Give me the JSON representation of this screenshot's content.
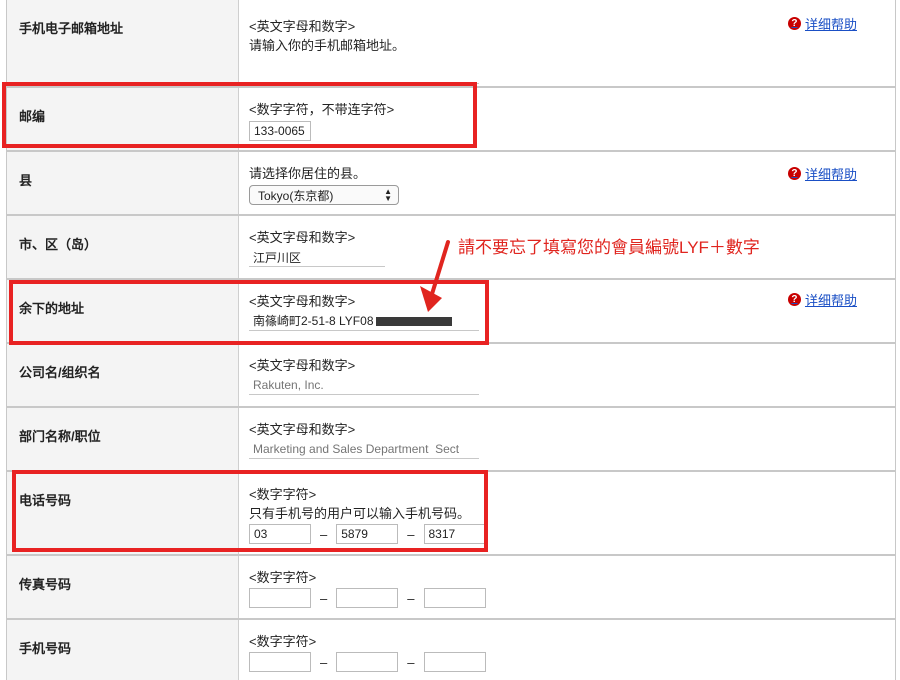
{
  "help_label": "详细帮助",
  "help_icon": "question-circle-icon",
  "rows": {
    "email": {
      "label": "手机电子邮箱地址",
      "hint1": "<英文字母和数字>",
      "hint2": "请输入你的手机邮箱地址。",
      "value": ""
    },
    "zip": {
      "label": "邮编",
      "hint1": "<数字字符，不带连字符>",
      "value": "133-0065"
    },
    "prefecture": {
      "label": "县",
      "hint1": "请选择你居住的县。",
      "selected": "Tokyo(东京都)"
    },
    "city": {
      "label": "市、区（岛）",
      "hint1": "<英文字母和数字>",
      "value": "江戸川区"
    },
    "address": {
      "label": "余下的地址",
      "hint1": "<英文字母和数字>",
      "value": "南篠崎町2-51-8 LYF08"
    },
    "company": {
      "label": "公司名/组织名",
      "hint1": "<英文字母和数字>",
      "placeholder": "Rakuten, Inc."
    },
    "department": {
      "label": "部门名称/职位",
      "hint1": "<英文字母和数字>",
      "placeholder": "Marketing and Sales Department  Sect"
    },
    "phone": {
      "label": "电话号码",
      "hint1": "<数字字符>",
      "hint2": "只有手机号的用户可以输入手机号码。",
      "part1": "03",
      "part2": "5879",
      "part3": "8317"
    },
    "fax": {
      "label": "传真号码",
      "hint1": "<数字字符>",
      "part1": "",
      "part2": "",
      "part3": ""
    },
    "mobile": {
      "label": "手机号码",
      "hint1": "<数字字符>"
    }
  },
  "dash": "–",
  "annotation": "請不要忘了填寫您的會員編號LYF＋數字",
  "annotation_color": "#e0251f"
}
